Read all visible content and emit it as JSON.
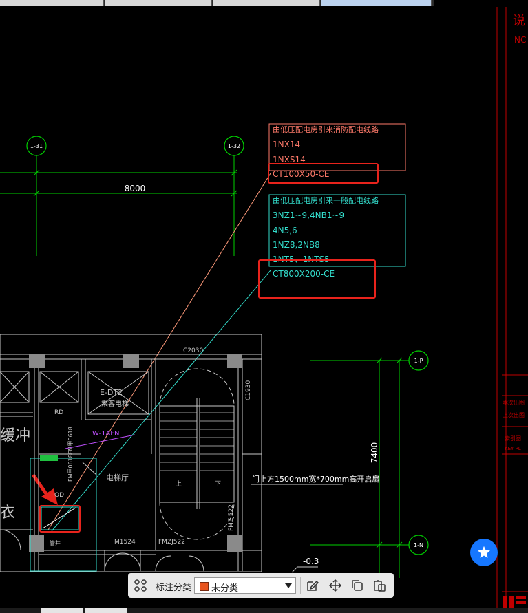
{
  "drawing": {
    "grid_bubbles": {
      "a": "1-31",
      "b": "1-32",
      "c": "1-P",
      "d": "1-N"
    },
    "dim_top": "8000",
    "dim_right": "7400",
    "note1": {
      "title": "由低压配电房引来消防配电线路",
      "line1": "1NX14",
      "line2": "1NXS14",
      "line3": "CT100X50-CE"
    },
    "note2": {
      "title": "由低压配电房引来一般配电线路",
      "line1": "3NZ1~9,4NB1~9",
      "line2": "4N5,6",
      "line3": "1NZ8,2NB8",
      "line4": "1NT5、1NTS5",
      "line5": "CT800X200-CE"
    },
    "room_labels": {
      "elevator": "E-DT2",
      "elevator_desc": "乘客电梯",
      "hall": "电梯厅",
      "rd": "RD",
      "od": "OD",
      "buffer": "缓冲",
      "cloth": "衣",
      "pipe": "管井",
      "w_label": "W-1AFN",
      "door1": "M1524",
      "door2": "FMZJ522",
      "door3": "FMZJ522",
      "window": "C2030",
      "window2": "C1930",
      "stair_up": "上",
      "stair_down": "下",
      "level": "-0.3",
      "opening": "门上方1500mm宽*700mm高开启扇",
      "fm": "FM甲0618",
      "fm2": "FM甲0618"
    },
    "title_block": {
      "t1": "说",
      "t2": "NC",
      "t3": "本次出图",
      "t4": "上次出图",
      "t5": "索引图",
      "t6": "KEY PL"
    }
  },
  "toolbar": {
    "label": "标注分类",
    "selected": "未分类",
    "swatch_color": "#e8541e"
  },
  "colors": {
    "accent": "#1677ff",
    "highlight": "#e8231c",
    "green": "#00e000",
    "cyan": "#33ddcc"
  }
}
